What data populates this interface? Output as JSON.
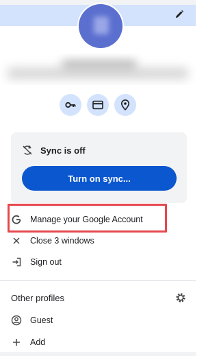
{
  "profile": {
    "edit_icon": "pencil-icon",
    "accent": "#d3e3fd",
    "avatar_color": "#5b6fcf"
  },
  "quick_actions": [
    {
      "icon": "key-icon"
    },
    {
      "icon": "credit-card-icon"
    },
    {
      "icon": "location-pin-icon"
    }
  ],
  "sync": {
    "status_text": "Sync is off",
    "status_icon": "sync-off-icon",
    "button_label": "Turn on sync...",
    "button_color": "#0b57d0"
  },
  "menu": {
    "manage_account": "Manage your Google Account",
    "close_windows": "Close 3 windows",
    "sign_out": "Sign out"
  },
  "other_profiles": {
    "title": "Other profiles",
    "settings_icon": "gear-icon",
    "guest": "Guest",
    "add": "Add"
  },
  "annotation": {
    "highlight_color": "#e5484d"
  }
}
